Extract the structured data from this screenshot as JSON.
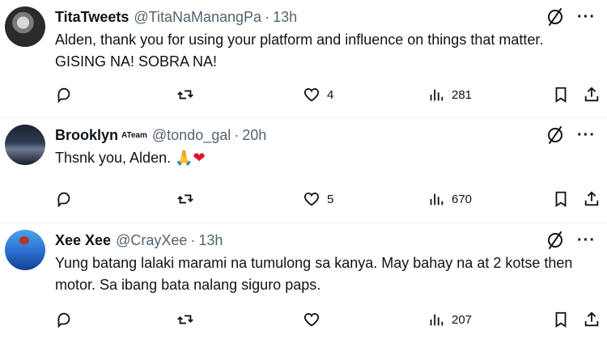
{
  "tweets": [
    {
      "name": "TitaTweets",
      "badge": "",
      "handle": "@TitaNaManangPa",
      "dot": "·",
      "time": "13h",
      "text": "Alden, thank you for using your platform and influence on things that matter. GISING NA! SOBRA NA!",
      "likes": "4",
      "views": "281"
    },
    {
      "name": "Brooklyn",
      "badge": "ATeam",
      "handle": "@tondo_gal",
      "dot": "·",
      "time": "20h",
      "text": "Thsnk you, Alden. ",
      "emoji1": "🙏",
      "emoji2": "❤",
      "likes": "5",
      "views": "670"
    },
    {
      "name": "Xee Xee",
      "badge": "",
      "handle": "@CrayXee",
      "dot": "·",
      "time": "13h",
      "text": "Yung batang lalaki marami na tumulong sa kanya. May bahay na at 2 kotse then motor. Sa ibang bata nalang siguro paps.",
      "likes": "",
      "views": "207"
    }
  ],
  "icons": {
    "more": "···",
    "grok": "grok-icon",
    "reply": "reply-icon",
    "retweet": "retweet-icon",
    "like": "heart-icon",
    "views": "views-icon",
    "bookmark": "bookmark-icon",
    "share": "share-icon"
  },
  "colors": {
    "text": "#0f1419",
    "secondary": "#536471",
    "divider": "#eff3f4"
  }
}
